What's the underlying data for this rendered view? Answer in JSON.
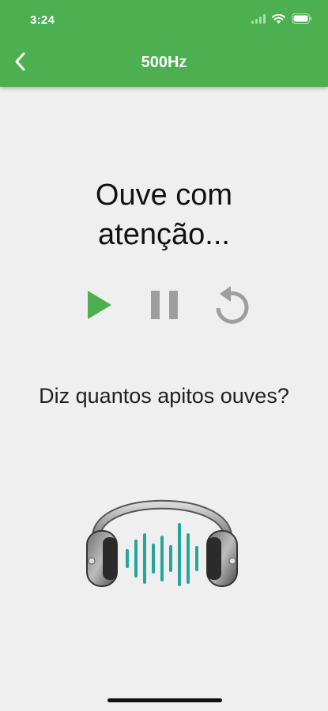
{
  "status_bar": {
    "time": "3:24"
  },
  "header": {
    "title": "500Hz",
    "back_icon": "chevron-left-icon",
    "background_color": "#4caf50"
  },
  "main": {
    "instruction": "Ouve com atenção...",
    "controls": [
      {
        "name": "play",
        "icon": "play-icon",
        "color": "#4caf50"
      },
      {
        "name": "pause",
        "icon": "pause-icon",
        "color": "#9e9e9e"
      },
      {
        "name": "replay",
        "icon": "replay-icon",
        "color": "#9e9e9e"
      }
    ],
    "question": "Diz quantos apitos ouves?",
    "illustration": "headphones-soundwave-icon",
    "accent_color": "#26a69a"
  }
}
